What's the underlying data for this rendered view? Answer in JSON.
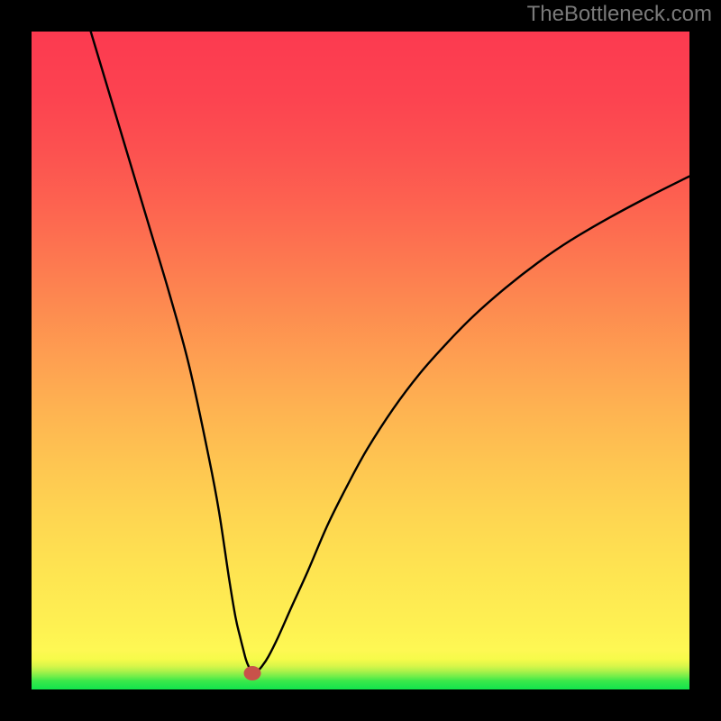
{
  "watermark": "TheBottleneck.com",
  "chart_data": {
    "type": "line",
    "title": "",
    "xlabel": "",
    "ylabel": "",
    "xlim": [
      0,
      100
    ],
    "ylim": [
      0,
      100
    ],
    "grid": false,
    "legend": false,
    "marker": {
      "x": 33.5,
      "y": 2.5,
      "color": "#c8524a",
      "rx": 1.3,
      "ry": 1.1
    },
    "series": [
      {
        "name": "bottleneck-curve",
        "color": "#000000",
        "x": [
          9,
          12,
          15,
          18,
          21,
          24,
          27,
          28.5,
          30,
          31,
          31.7,
          32.2,
          32.6,
          33.0,
          33.5,
          34.2,
          35.0,
          36.0,
          37.5,
          39.5,
          42,
          45,
          48,
          51,
          55,
          59,
          63,
          67,
          72,
          77,
          82,
          88,
          94,
          100
        ],
        "y": [
          100,
          90,
          80,
          70,
          60,
          49,
          35,
          27,
          17,
          11,
          8,
          6,
          4.5,
          3.5,
          2.7,
          2.7,
          3.5,
          5.0,
          8.0,
          12.5,
          18,
          25,
          31,
          36.5,
          42.7,
          48.0,
          52.5,
          56.6,
          61.0,
          64.9,
          68.3,
          71.8,
          75.0,
          78.0
        ]
      }
    ],
    "background": {
      "type": "vertical-gradient",
      "stops": [
        {
          "pos": 0.0,
          "color": "#12e44c"
        },
        {
          "pos": 0.013,
          "color": "#3ae84a"
        },
        {
          "pos": 0.02,
          "color": "#73ee4a"
        },
        {
          "pos": 0.028,
          "color": "#aef24a"
        },
        {
          "pos": 0.036,
          "color": "#d9f64a"
        },
        {
          "pos": 0.046,
          "color": "#f6fa4a"
        },
        {
          "pos": 0.06,
          "color": "#fef853"
        },
        {
          "pos": 0.1,
          "color": "#fef052"
        },
        {
          "pos": 0.18,
          "color": "#fee451"
        },
        {
          "pos": 0.26,
          "color": "#fed651"
        },
        {
          "pos": 0.34,
          "color": "#fec651"
        },
        {
          "pos": 0.42,
          "color": "#feb451"
        },
        {
          "pos": 0.5,
          "color": "#fea051"
        },
        {
          "pos": 0.58,
          "color": "#fd8b50"
        },
        {
          "pos": 0.66,
          "color": "#fd7650"
        },
        {
          "pos": 0.74,
          "color": "#fd6250"
        },
        {
          "pos": 0.82,
          "color": "#fc5150"
        },
        {
          "pos": 0.9,
          "color": "#fc4350"
        },
        {
          "pos": 1.0,
          "color": "#fc3a50"
        }
      ]
    }
  }
}
